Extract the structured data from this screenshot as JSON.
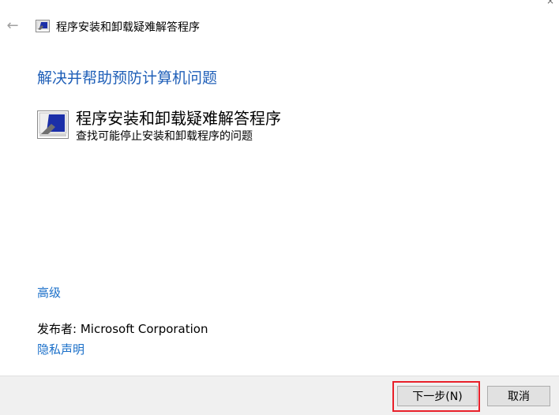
{
  "window": {
    "title": "程序安装和卸载疑难解答程序",
    "back_icon": "back-arrow-icon",
    "app_icon": "troubleshooter-icon"
  },
  "main": {
    "heading": "解决并帮助预防计算机问题",
    "item": {
      "title": "程序安装和卸载疑难解答程序",
      "description": "查找可能停止安装和卸载程序的问题",
      "icon": "troubleshooter-icon"
    },
    "advanced_link": "高级",
    "publisher_label": "发布者:",
    "publisher_value": "Microsoft Corporation",
    "privacy_link": "隐私声明"
  },
  "footer": {
    "next_label": "下一步(N)",
    "cancel_label": "取消"
  },
  "colors": {
    "heading": "#1f5fb8",
    "link": "#1a6fc9",
    "highlight": "#e8202a",
    "footer_bg": "#f0f0f0"
  }
}
